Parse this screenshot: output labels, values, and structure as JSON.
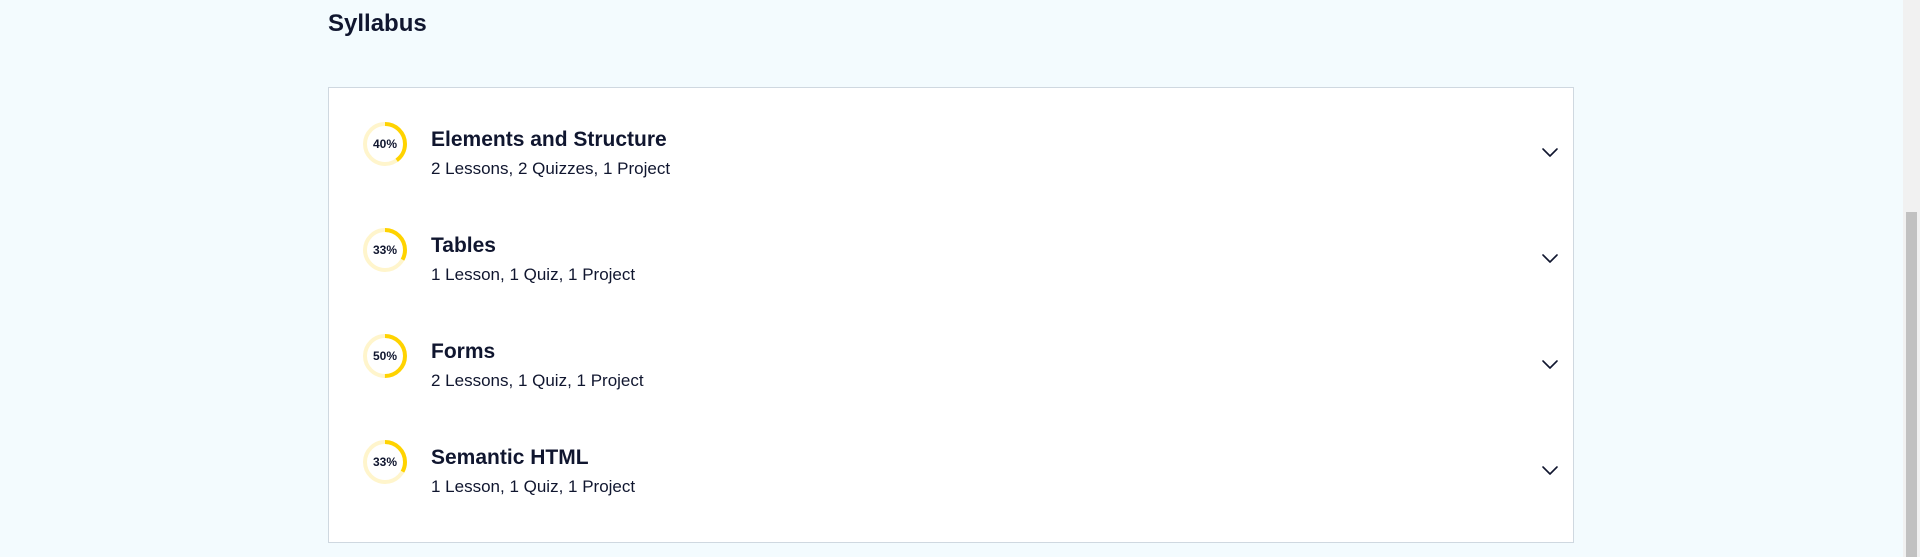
{
  "syllabus": {
    "title": "Syllabus"
  },
  "colors": {
    "progress_fill": "#ffd300",
    "progress_track": "#fff5cc",
    "page_background": "#f3fbfe"
  },
  "modules": [
    {
      "title": "Elements and Structure",
      "meta": "2 Lessons, 2 Quizzes, 1 Project",
      "progress_label": "40%",
      "progress": 0.4,
      "chevron_icon": "chevron-down-icon"
    },
    {
      "title": "Tables",
      "meta": "1 Lesson, 1 Quiz, 1 Project",
      "progress_label": "33%",
      "progress": 0.33,
      "chevron_icon": "chevron-down-icon"
    },
    {
      "title": "Forms",
      "meta": "2 Lessons, 1 Quiz, 1 Project",
      "progress_label": "50%",
      "progress": 0.5,
      "chevron_icon": "chevron-down-icon"
    },
    {
      "title": "Semantic HTML",
      "meta": "1 Lesson, 1 Quiz, 1 Project",
      "progress_label": "33%",
      "progress": 0.33,
      "chevron_icon": "chevron-down-icon"
    }
  ]
}
